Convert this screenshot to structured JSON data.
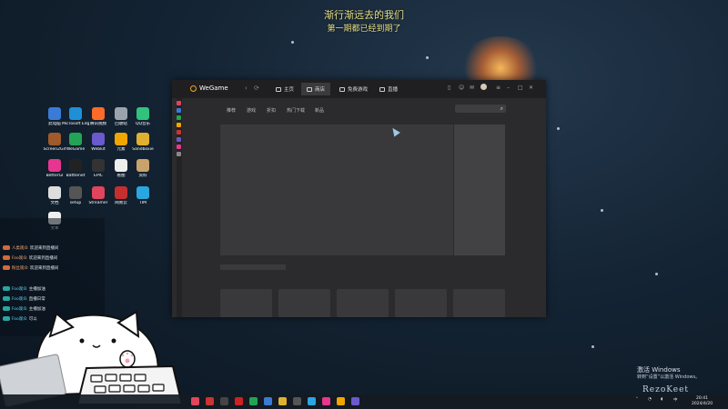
{
  "lyrics": {
    "line1": "渐行渐远去的我们",
    "line2": "第一期都已经到期了"
  },
  "desktop": {
    "icons": [
      {
        "label": "此电脑",
        "color": "#3a7bd5"
      },
      {
        "label": "Microsoft Edge",
        "color": "#1f8fd6"
      },
      {
        "label": "腾讯视频",
        "color": "#ff6a2b"
      },
      {
        "label": "回收站",
        "color": "#9aa4ae"
      },
      {
        "label": "QQ音乐",
        "color": "#31c27c"
      },
      {
        "label": "Screen2Gif",
        "color": "#a05a2c"
      },
      {
        "label": "WeGame",
        "color": "#23a455"
      },
      {
        "label": "Webkit",
        "color": "#6a5acd"
      },
      {
        "label": "元素",
        "color": "#f0a500"
      },
      {
        "label": "Sandboxie",
        "color": "#e0b030"
      },
      {
        "label": "BetterGI",
        "color": "#e7368f"
      },
      {
        "label": "Battlenet",
        "color": "#222222"
      },
      {
        "label": "EPIC",
        "color": "#333333"
      },
      {
        "label": "看图",
        "color": "#eeeeee"
      },
      {
        "label": "资料",
        "color": "#caa36b"
      },
      {
        "label": "文档",
        "color": "#dddddd"
      },
      {
        "label": "setup",
        "color": "#555555"
      },
      {
        "label": "Streamer",
        "color": "#e0455c"
      },
      {
        "label": "网易云",
        "color": "#c62f2f"
      },
      {
        "label": "TIM",
        "color": "#2aa6e0"
      },
      {
        "label": "文本",
        "color": "#f0f0f0"
      }
    ]
  },
  "chat": {
    "header": "",
    "messages": [
      {
        "badge": "",
        "user": "人类观众",
        "text": "欢迎来到直播间",
        "badge_color": "#d06b3c"
      },
      {
        "badge": "",
        "user": "Foo观众",
        "text": "欢迎来到直播间",
        "badge_color": "#d06b3c"
      },
      {
        "badge": "",
        "user": "粉丝观众",
        "text": "欢迎来到直播间",
        "badge_color": "#d06b3c"
      },
      {
        "badge": "",
        "user": "Foo观众",
        "text": "主播加油",
        "badge_color": "#2aa6a0"
      },
      {
        "badge": "",
        "user": "Foo观众",
        "text": "直播日常",
        "badge_color": "#2aa6a0"
      },
      {
        "badge": "",
        "user": "Foo观众",
        "text": "主播加油",
        "badge_color": "#2aa6a0"
      },
      {
        "badge": "",
        "user": "Foo观众",
        "text": "可以",
        "badge_color": "#2aa6a0"
      }
    ]
  },
  "wegame": {
    "logo_text": "WeGame",
    "tabs": [
      {
        "label": "主页"
      },
      {
        "label": "商店"
      },
      {
        "label": "免费游戏"
      },
      {
        "label": "直播"
      }
    ],
    "active_tab": 1,
    "subnav": [
      "推荐",
      "游戏",
      "折扣",
      "热门下载",
      "新品"
    ],
    "nav_back": "‹",
    "nav_fwd": "›",
    "nav_refresh": "⟳",
    "window_controls": [
      "–",
      "□",
      "✕"
    ],
    "search_icon": "⌕"
  },
  "activation": {
    "title": "激活 Windows",
    "subtitle": "转到“设置”以激活 Windows。"
  },
  "signature": "RezoKeet",
  "taskbar": {
    "icons": [
      {
        "name": "start",
        "color": "#e0455c"
      },
      {
        "name": "app1",
        "color": "#cc3333"
      },
      {
        "name": "app2",
        "color": "#444444"
      },
      {
        "name": "app3",
        "color": "#cc2222"
      },
      {
        "name": "app4",
        "color": "#23a455"
      },
      {
        "name": "app5",
        "color": "#3a7bd5"
      },
      {
        "name": "app6",
        "color": "#e0b030"
      },
      {
        "name": "app7",
        "color": "#555555"
      },
      {
        "name": "app8",
        "color": "#2aa6e0"
      },
      {
        "name": "app9",
        "color": "#e7368f"
      },
      {
        "name": "app10",
        "color": "#f0a500"
      },
      {
        "name": "app11",
        "color": "#6a5acd"
      }
    ],
    "clock_time": "20:41",
    "clock_date": "2024/4/20"
  }
}
